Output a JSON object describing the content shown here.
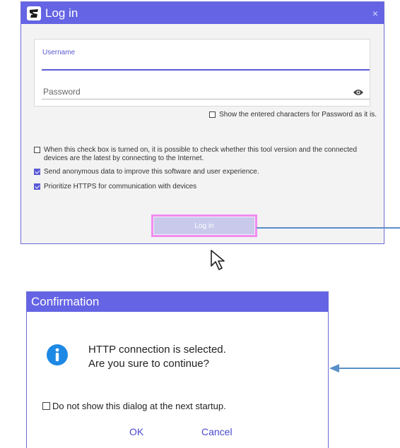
{
  "login": {
    "title": "Log in",
    "close_glyph": "×",
    "username_label": "Username",
    "username_value": "",
    "password_placeholder": "Password",
    "show_password_label": "Show the entered characters for Password as it is.",
    "show_password_checked": false,
    "options": [
      {
        "label": "When this check box is turned on, it is possible to check whether this tool version and the connected devices are the latest by connecting to the Internet.",
        "checked": false
      },
      {
        "label": "Send anonymous data to improve this software and user experience.",
        "checked": true
      },
      {
        "label": "Prioritize HTTPS for communication with devices",
        "checked": true
      }
    ],
    "login_button": "Log in"
  },
  "confirm": {
    "title": "Confirmation",
    "message_line1": "HTTP connection is selected.",
    "message_line2": "Are you sure to continue?",
    "dont_show_label": "Do not show this dialog at the next startup.",
    "ok": "OK",
    "cancel": "Cancel"
  },
  "colors": {
    "titlebar": "#6464e4",
    "accent": "#5a5ad6",
    "highlight": "#f08cf0",
    "annotation_arrow": "#5b8fc8",
    "info": "#1e88e5"
  },
  "icons": {
    "app": "app-logo-icon",
    "close": "close-icon",
    "eye": "eye-icon",
    "info": "info-icon",
    "cursor": "mouse-cursor-icon"
  }
}
